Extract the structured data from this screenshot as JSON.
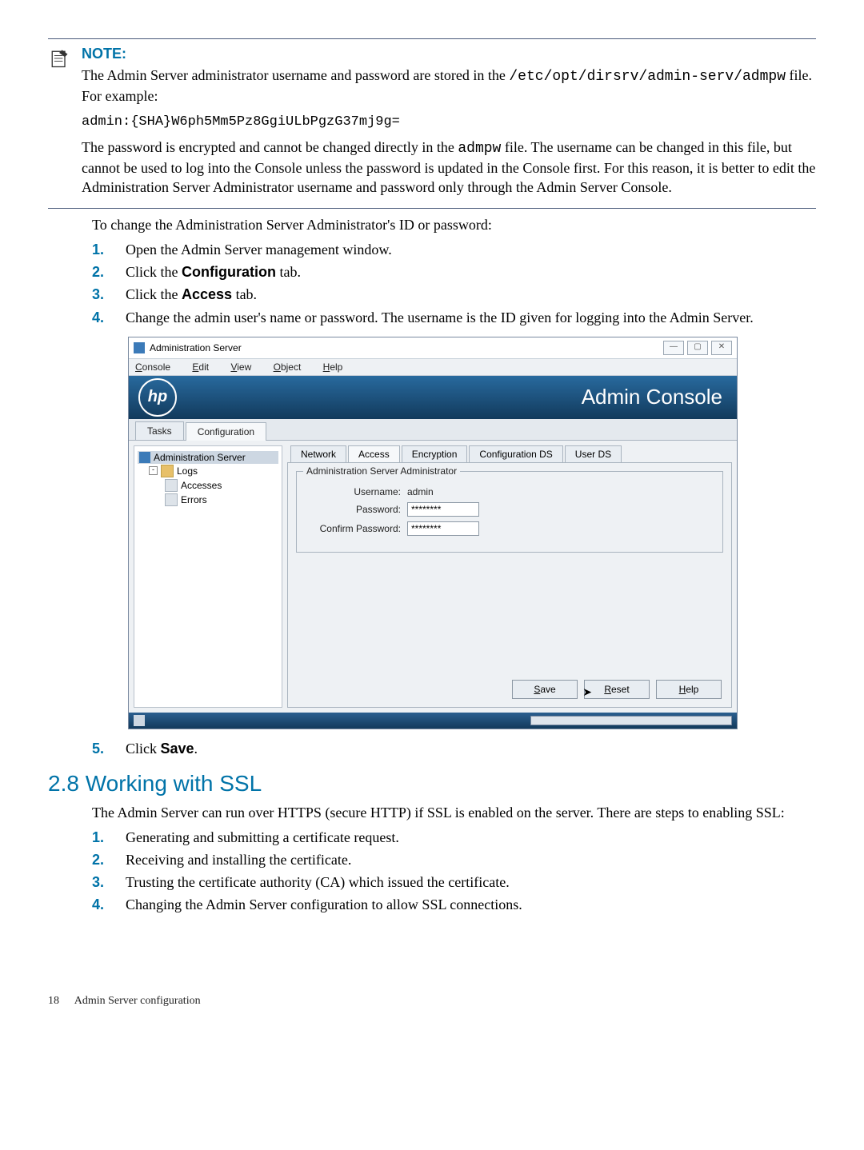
{
  "note": {
    "heading": "NOTE:",
    "line1_a": "The Admin Server administrator username and password are stored in the ",
    "line1_code": "/etc/opt/dirsrv/admin-serv/admpw",
    "line1_b": " file. For example:",
    "code_block": "admin:{SHA}W6ph5Mm5Pz8GgiULbPgzG37mj9g=",
    "para2_a": "The password is encrypted and cannot be changed directly in the ",
    "para2_code": "admpw",
    "para2_b": " file. The username can be changed in this file, but cannot be used to log into the Console unless the password is updated in the Console first. For this reason, it is better to edit the Administration Server Administrator username and password only through the Admin Server Console."
  },
  "intro": "To change the Administration Server Administrator's ID or password:",
  "steps_a": [
    {
      "n": "1.",
      "t": "Open the Admin Server management window."
    },
    {
      "n": "2.",
      "pre": "Click the ",
      "bold": "Configuration",
      "post": " tab."
    },
    {
      "n": "3.",
      "pre": "Click the ",
      "bold": "Access",
      "post": " tab."
    },
    {
      "n": "4.",
      "t": "Change the admin user's name or password. The username is the ID given for logging into the Admin Server."
    }
  ],
  "screenshot": {
    "title": "Administration Server",
    "menus": {
      "console": "Console",
      "edit": "Edit",
      "view": "View",
      "object": "Object",
      "help": "Help"
    },
    "logo": "hp",
    "banner": "Admin Console",
    "main_tabs": {
      "tasks": "Tasks",
      "config": "Configuration"
    },
    "tree": {
      "root": "Administration Server",
      "logs": "Logs",
      "accesses": "Accesses",
      "errors": "Errors"
    },
    "inner_tabs": {
      "network": "Network",
      "access": "Access",
      "encryption": "Encryption",
      "configds": "Configuration DS",
      "userds": "User DS"
    },
    "fieldset_legend": "Administration Server Administrator",
    "labels": {
      "username": "Username:",
      "password": "Password:",
      "confirm": "Confirm Password:"
    },
    "values": {
      "username": "admin",
      "password": "********",
      "confirm": "********"
    },
    "buttons": {
      "save": "Save",
      "reset": "Reset",
      "help": "Help"
    }
  },
  "steps_b": [
    {
      "n": "5.",
      "pre": "Click ",
      "bold": "Save",
      "post": "."
    }
  ],
  "section": {
    "heading": "2.8 Working with SSL",
    "intro": "The Admin Server can run over HTTPS (secure HTTP) if SSL is enabled on the server. There are steps to enabling SSL:",
    "items": [
      {
        "n": "1.",
        "t": "Generating and submitting a certificate request."
      },
      {
        "n": "2.",
        "t": "Receiving and installing the certificate."
      },
      {
        "n": "3.",
        "t": "Trusting the certificate authority (CA) which issued the certificate."
      },
      {
        "n": "4.",
        "t": "Changing the Admin Server configuration to allow SSL connections."
      }
    ]
  },
  "footer": {
    "page": "18",
    "title": "Admin Server configuration"
  }
}
